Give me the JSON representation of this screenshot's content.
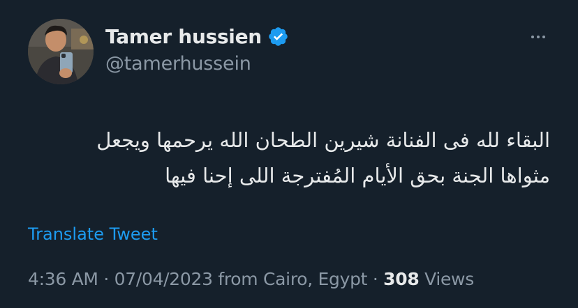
{
  "author": {
    "display_name": "Tamer hussien",
    "handle": "@tamerhussein",
    "verified": true,
    "avatar_icon": "profile-photo"
  },
  "tweet": {
    "text_line_1": "البقاء لله فى الفنانة شيرين الطحان الله يرحمها ويجعل",
    "text_line_2": "مثواها الجنة بحق الأيام المُفترجة اللى إحنا فيها",
    "translate_label": "Translate Tweet"
  },
  "meta": {
    "time": "4:36 AM",
    "separator_1": " · ",
    "date": "07/04/2023",
    "location": " from Cairo, Egypt",
    "separator_2": " · ",
    "views_count": "308",
    "views_label": " Views"
  },
  "colors": {
    "background": "#15202b",
    "primary_text": "#e7e9ea",
    "secondary_text": "#8b98a5",
    "accent": "#1d9bf0"
  },
  "icons": {
    "verified": "verified-badge-icon",
    "more": "more-options-icon"
  }
}
